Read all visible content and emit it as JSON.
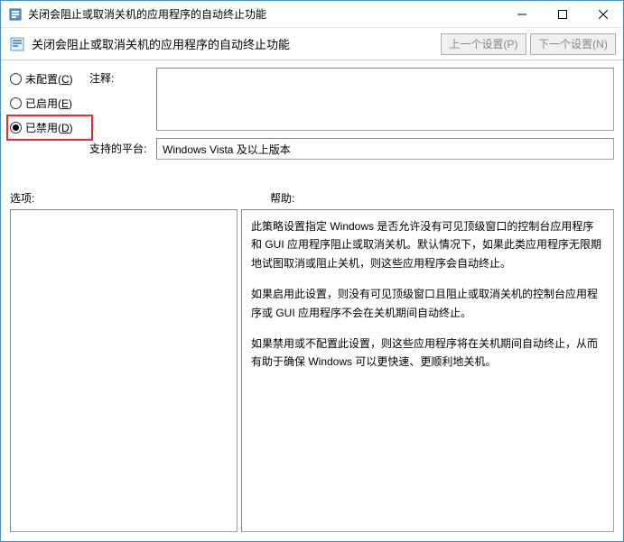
{
  "titlebar": {
    "title": "关闭会阻止或取消关机的应用程序的自动终止功能"
  },
  "header": {
    "title": "关闭会阻止或取消关机的应用程序的自动终止功能",
    "prev_btn": "上一个设置(P)",
    "next_btn": "下一个设置(N)"
  },
  "radios": {
    "not_configured": "未配置(",
    "not_configured_key": "C",
    "not_configured_end": ")",
    "enabled": "已启用(",
    "enabled_key": "E",
    "enabled_end": ")",
    "disabled": "已禁用(",
    "disabled_key": "D",
    "disabled_end": ")",
    "selected": "disabled"
  },
  "fields": {
    "comment_label": "注释:",
    "platform_label": "支持的平台:",
    "platform_value": "Windows Vista 及以上版本"
  },
  "sections": {
    "options_label": "选项:",
    "help_label": "帮助:"
  },
  "help": {
    "p1": "此策略设置指定 Windows 是否允许没有可见顶级窗口的控制台应用程序和 GUI 应用程序阻止或取消关机。默认情况下，如果此类应用程序无限期地试图取消或阻止关机，则这些应用程序会自动终止。",
    "p2": "如果启用此设置，则没有可见顶级窗口且阻止或取消关机的控制台应用程序或 GUI 应用程序不会在关机期间自动终止。",
    "p3": "如果禁用或不配置此设置，则这些应用程序将在关机期间自动终止，从而有助于确保 Windows 可以更快速、更顺利地关机。"
  }
}
